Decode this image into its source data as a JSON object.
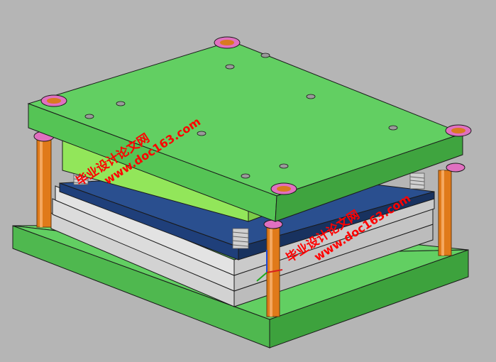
{
  "watermarks": [
    {
      "line1": "毕业设计论文网",
      "line2": "www.doc163.com"
    },
    {
      "line1": "毕业设计论文网",
      "line2": "www.doc163.com"
    }
  ],
  "colors": {
    "background": "#b5b5b5",
    "plate_green": "#5fcf5f",
    "plate_green_dark": "#3e9e3e",
    "stripper_green": "#8fe65a",
    "cavity_blue": "#1f3f7a",
    "steel_plate": "#d9d9d9",
    "guide_pillar": "#e07a1a",
    "bushing": "#e070c0",
    "spring": "#c0c0c0",
    "watermark": "#ff0000"
  }
}
